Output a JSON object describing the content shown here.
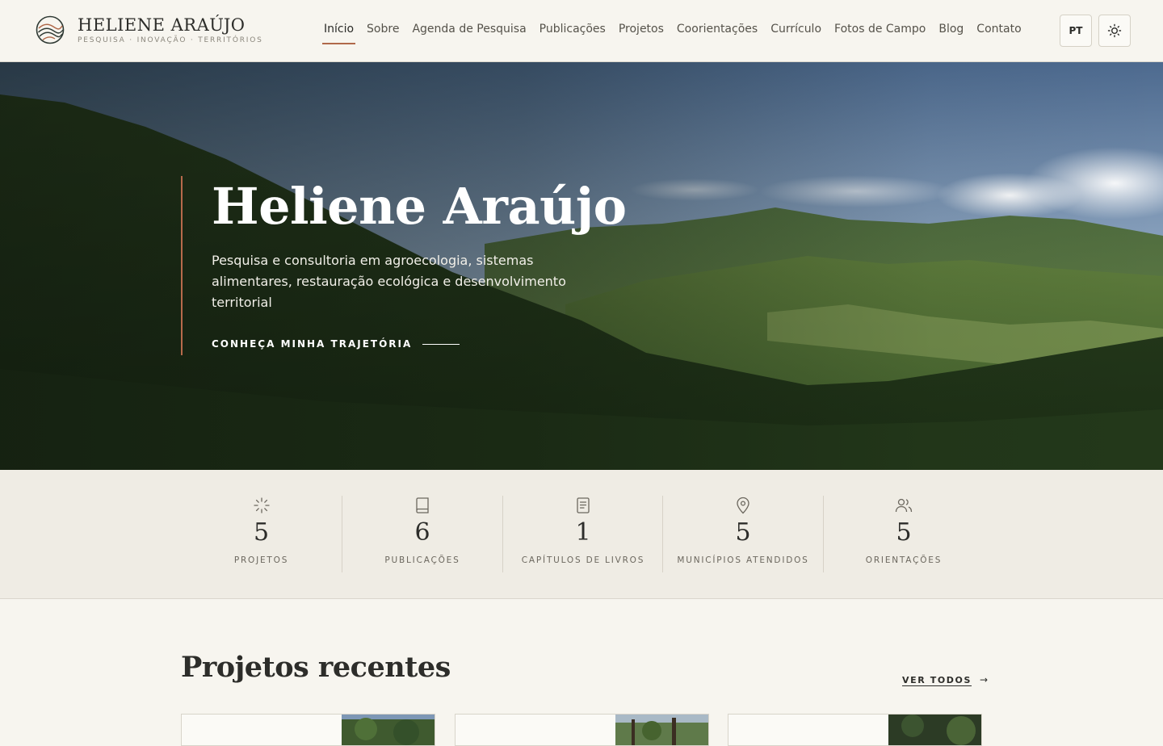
{
  "brand": {
    "name": "HELIENE ARAÚJO",
    "tagline": "PESQUISA · INOVAÇÃO · TERRITÓRIOS"
  },
  "nav": {
    "items": [
      {
        "label": "Início",
        "active": true
      },
      {
        "label": "Sobre"
      },
      {
        "label": "Agenda de Pesquisa"
      },
      {
        "label": "Publicações"
      },
      {
        "label": "Projetos"
      },
      {
        "label": "Coorientações"
      },
      {
        "label": "Currículo"
      },
      {
        "label": "Fotos de Campo"
      },
      {
        "label": "Blog"
      },
      {
        "label": "Contato"
      }
    ],
    "language": "PT",
    "theme_icon": "sun-icon"
  },
  "hero": {
    "title": "Heliene Araújo",
    "subtitle": "Pesquisa e consultoria em agroecologia, sistemas alimentares, restauração ecológica e desenvolvimento territorial",
    "cta": "CONHEÇA MINHA TRAJETÓRIA"
  },
  "stats": [
    {
      "icon": "sparkle-icon",
      "value": "5",
      "label": "PROJETOS"
    },
    {
      "icon": "book-icon",
      "value": "6",
      "label": "PUBLICAÇÕES"
    },
    {
      "icon": "document-icon",
      "value": "1",
      "label": "CAPÍTULOS DE LIVROS"
    },
    {
      "icon": "map-pin-icon",
      "value": "5",
      "label": "MUNICÍPIOS ATENDIDOS"
    },
    {
      "icon": "users-icon",
      "value": "5",
      "label": "ORIENTAÇÕES"
    }
  ],
  "projects": {
    "title": "Projetos recentes",
    "view_all": "VER TODOS",
    "arrow_icon": "arrow-right-icon"
  },
  "colors": {
    "accent": "#b0694a",
    "background": "#f7f5ef",
    "stats_background": "#efece4"
  }
}
